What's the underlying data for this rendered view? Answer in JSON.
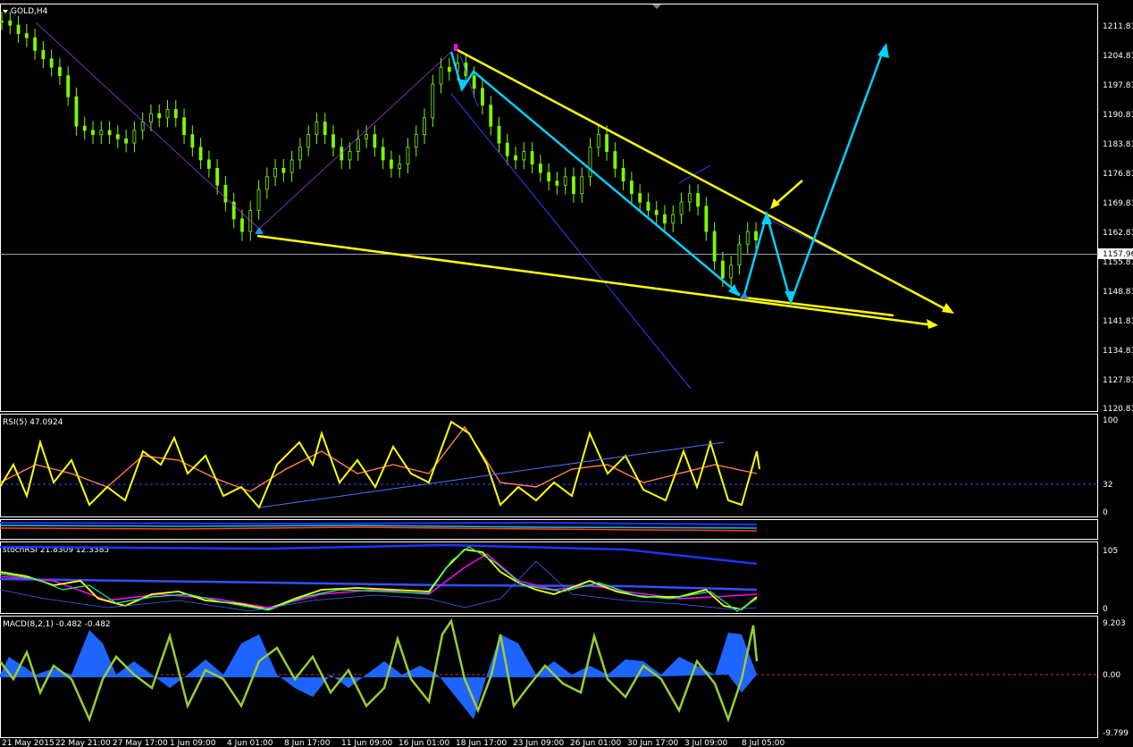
{
  "window": {
    "title": "GOLD,H4"
  },
  "current_price": "1157.96",
  "price_axis": [
    "1211.81",
    "1204.81",
    "1197.81",
    "1190.81",
    "1183.81",
    "1176.81",
    "1169.81",
    "1162.81",
    "1155.81",
    "1148.81",
    "1141.81",
    "1134.81",
    "1127.81",
    "1120.81"
  ],
  "rsi": {
    "title": "RSI(5) 47.0924",
    "levels": [
      "100",
      "32",
      "0"
    ]
  },
  "stoch": {
    "title": "stochRSI 21.8309 12.3385",
    "levels": [
      "105",
      "0"
    ]
  },
  "macd": {
    "title": "MACD(8,2,1) -0.482 -0.482",
    "levels": [
      "9.203",
      "0.00",
      "-9.799"
    ]
  },
  "time_axis": [
    "21 May 2015",
    "22 May 21:00",
    "27 May 17:00",
    "1 Jun 09:00",
    "4 Jun 01:00",
    "8 Jun 17:00",
    "11 Jun 09:00",
    "16 Jun 01:00",
    "18 Jun 17:00",
    "23 Jun 09:00",
    "26 Jun 01:00",
    "30 Jun 17:00",
    "3 Jul 09:00",
    "8 Jul 05:00"
  ],
  "colors": {
    "candles": "#7cfc00",
    "trendline": "#ffff00",
    "arrow": "#00d0ff",
    "channel": "#1e32ff",
    "rsi_line": "#ffff00",
    "rsi_signal": "#ff7f50",
    "stoch_main": "#ffff00",
    "stoch_signal": "#ff00ff",
    "macd_hist": "#1e64ff",
    "macd_line": "#9acd32"
  },
  "chart_data": {
    "type": "line",
    "series": [
      {
        "values": [
          1213,
          1212,
          1210,
          1209,
          1206,
          1204,
          1202,
          1200,
          1195,
          1188,
          1187,
          1186,
          1187,
          1186,
          1185,
          1184,
          1187,
          1189,
          1191,
          1190,
          1192,
          1190,
          1186,
          1183,
          1180,
          1178,
          1174,
          1170,
          1166,
          1163,
          1168,
          1173,
          1176,
          1178,
          1177,
          1180,
          1183,
          1186,
          1189,
          1186,
          1183,
          1180,
          1182,
          1185,
          1186,
          1183,
          1180,
          1178,
          1179,
          1183,
          1186,
          1190,
          1198,
          1202,
          1201,
          1203,
          1200,
          1197,
          1193,
          1188,
          1184,
          1181,
          1180,
          1182,
          1179,
          1177,
          1175,
          1174,
          1176,
          1172,
          1176,
          1183,
          1186,
          1182,
          1178,
          1175,
          1172,
          1170,
          1168,
          1167,
          1165,
          1167,
          1170,
          1172,
          1169,
          1163,
          1156,
          1152,
          1155,
          1160,
          1163,
          1161
        ]
      }
    ]
  }
}
